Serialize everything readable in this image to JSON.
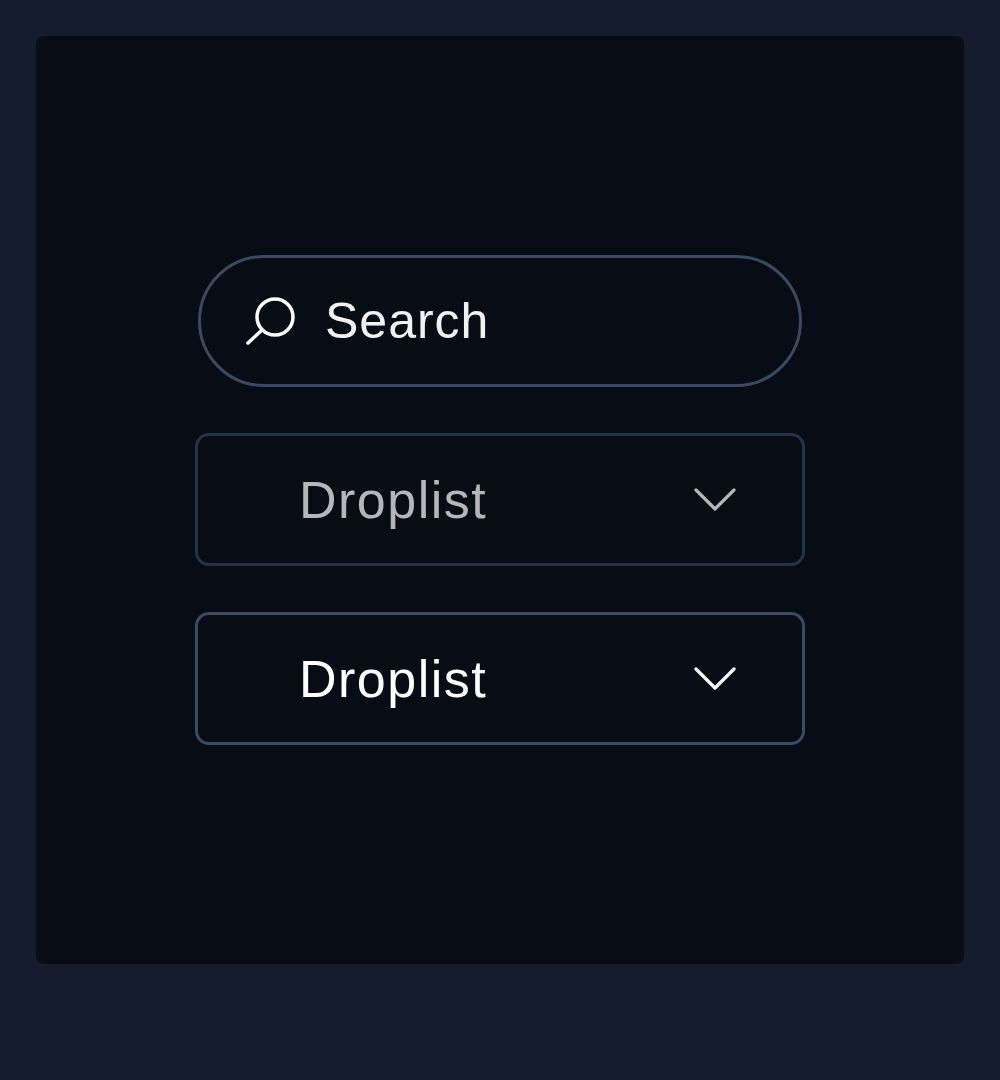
{
  "search": {
    "placeholder": "Search"
  },
  "droplists": [
    {
      "label": "Droplist",
      "disabled": true
    },
    {
      "label": "Droplist",
      "disabled": false
    }
  ]
}
